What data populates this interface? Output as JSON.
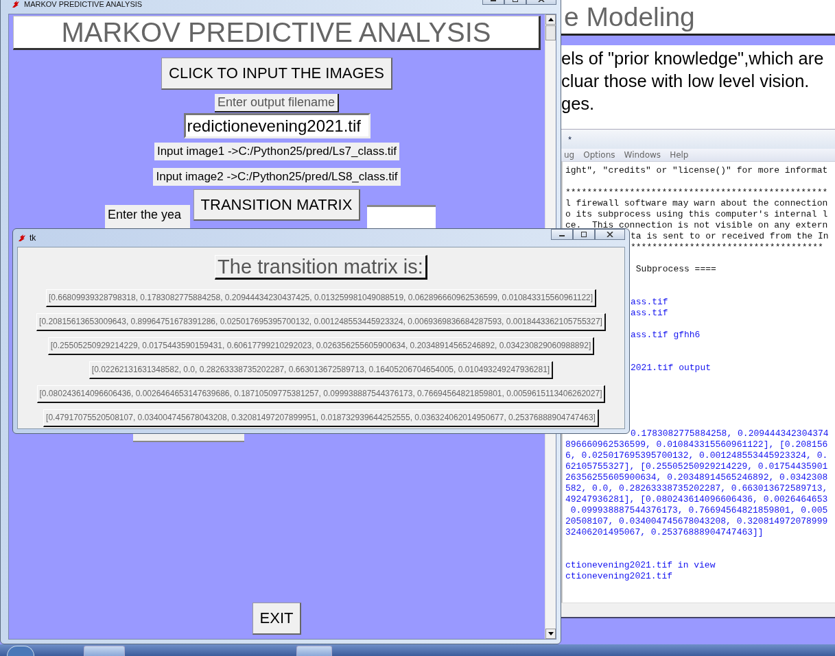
{
  "slide": {
    "title": "e Modeling",
    "lines": [
      "els of \"prior knowledge\",which are",
      "cluar those with low level vision.",
      "ges."
    ]
  },
  "shell": {
    "title": "*",
    "menu": [
      "ug",
      "Options",
      "Windows",
      "Help"
    ],
    "lines": [
      {
        "kind": "info",
        "text": "ight\", \"credits\" or \"license()\" for more informat"
      },
      {
        "kind": "blank"
      },
      {
        "kind": "info",
        "text": "*************************************************"
      },
      {
        "kind": "info",
        "text": "l firewall software may warn about the connection"
      },
      {
        "kind": "info",
        "text": "o its subprocess using this computer's internal l"
      },
      {
        "kind": "info",
        "text": "ce.  This connection is not visible on any extern"
      },
      {
        "kind": "info_tail",
        "text": "ta is sent to or received from the In"
      },
      {
        "kind": "info_tail",
        "text": "************************************"
      },
      {
        "kind": "blank"
      },
      {
        "kind": "info_tail",
        "text": " Subprocess ===="
      },
      {
        "kind": "blank"
      },
      {
        "kind": "blank"
      },
      {
        "kind": "output_tail",
        "text": "ass.tif"
      },
      {
        "kind": "output_tail",
        "text": "ass.tif"
      },
      {
        "kind": "blank"
      },
      {
        "kind": "output_tail",
        "text": "ass.tif gfhh6"
      },
      {
        "kind": "blank"
      },
      {
        "kind": "blank"
      },
      {
        "kind": "output_tail",
        "text": "2021.tif output"
      },
      {
        "kind": "blank"
      },
      {
        "kind": "blank"
      },
      {
        "kind": "blank"
      },
      {
        "kind": "blank"
      },
      {
        "kind": "blank"
      },
      {
        "kind": "output_tail",
        "text": "0.1783082775884258, 0.209444342304374"
      },
      {
        "kind": "output",
        "text": "896660962536599, 0.010843315560961122], [0.208156"
      },
      {
        "kind": "output",
        "text": "6, 0.025017695395700132, 0.001248553445923324, 0."
      },
      {
        "kind": "output",
        "text": "62105755327], [0.25505250929214229, 0.01754435901"
      },
      {
        "kind": "output",
        "text": "26356255605900634, 0.20348914565246892, 0.0342308"
      },
      {
        "kind": "output",
        "text": "582, 0.0, 0.28263338735202287, 0.663013672589713,"
      },
      {
        "kind": "output",
        "text": "49247936281], [0.080243614096606436, 0.0026464653"
      },
      {
        "kind": "output",
        "text": " 0.099938887544376173, 0.76694564821859801, 0.005"
      },
      {
        "kind": "output",
        "text": "20508107, 0.034004745678043208, 0.320814972078999"
      },
      {
        "kind": "output",
        "text": "32406201495067, 0.25376888904747463]]"
      },
      {
        "kind": "blank"
      },
      {
        "kind": "blank"
      },
      {
        "kind": "output",
        "text": "ctionevening2021.tif in view"
      },
      {
        "kind": "output",
        "text": "ctionevening2021.tif"
      }
    ]
  },
  "main_window": {
    "title": "MARKOV PREDICTIVE ANALYSIS",
    "heading": "MARKOV PREDICTIVE ANALYSIS",
    "input_button": "CLICK TO INPUT THE IMAGES",
    "filename_label": "Enter output filename",
    "filename_field": {
      "value": "redictionevening2021.tif"
    },
    "image_inputs": [
      "Input image1 ->C:/Python25/pred/Ls7_class.tif",
      "Input image2 ->C:/Python25/pred/LS8_class.tif"
    ],
    "matrix_button": "TRANSITION MATRIX",
    "year_label": "Enter the yea",
    "exit_button": "EXIT"
  },
  "matrix_window": {
    "title": "tk",
    "heading": "The transition matrix is:",
    "rows": [
      "[0.66809939328798318, 0.1783082775884258, 0.20944434230437425, 0.013259981049088519, 0.062896660962536599, 0.010843315560961122]",
      "[0.20815613653009643, 0.89964751678391286, 0.025017695395700132, 0.001248553445923324, 0.0069369836684287593, 0.0018443362105755327]",
      "[0.25505250929214229, 0.0175443590159431, 0.60617799210292023, 0.026356255605900634, 0.20348914565246892, 0.034230829060988892]",
      "[0.02262131631348582, 0.0, 0.28263338735202287, 0.663013672589713, 0.16405206704654005, 0.010493249247936281]",
      "[0.080243614096606436, 0.0026464653147639686, 0.18710509775381257, 0.099938887544376173, 0.76694564821859801, 0.0059615113406262027]",
      "[0.47917075520508107, 0.034004745678043208, 0.32081497207899951, 0.018732939644252555, 0.036324062014950677, 0.25376888904747463]"
    ]
  }
}
